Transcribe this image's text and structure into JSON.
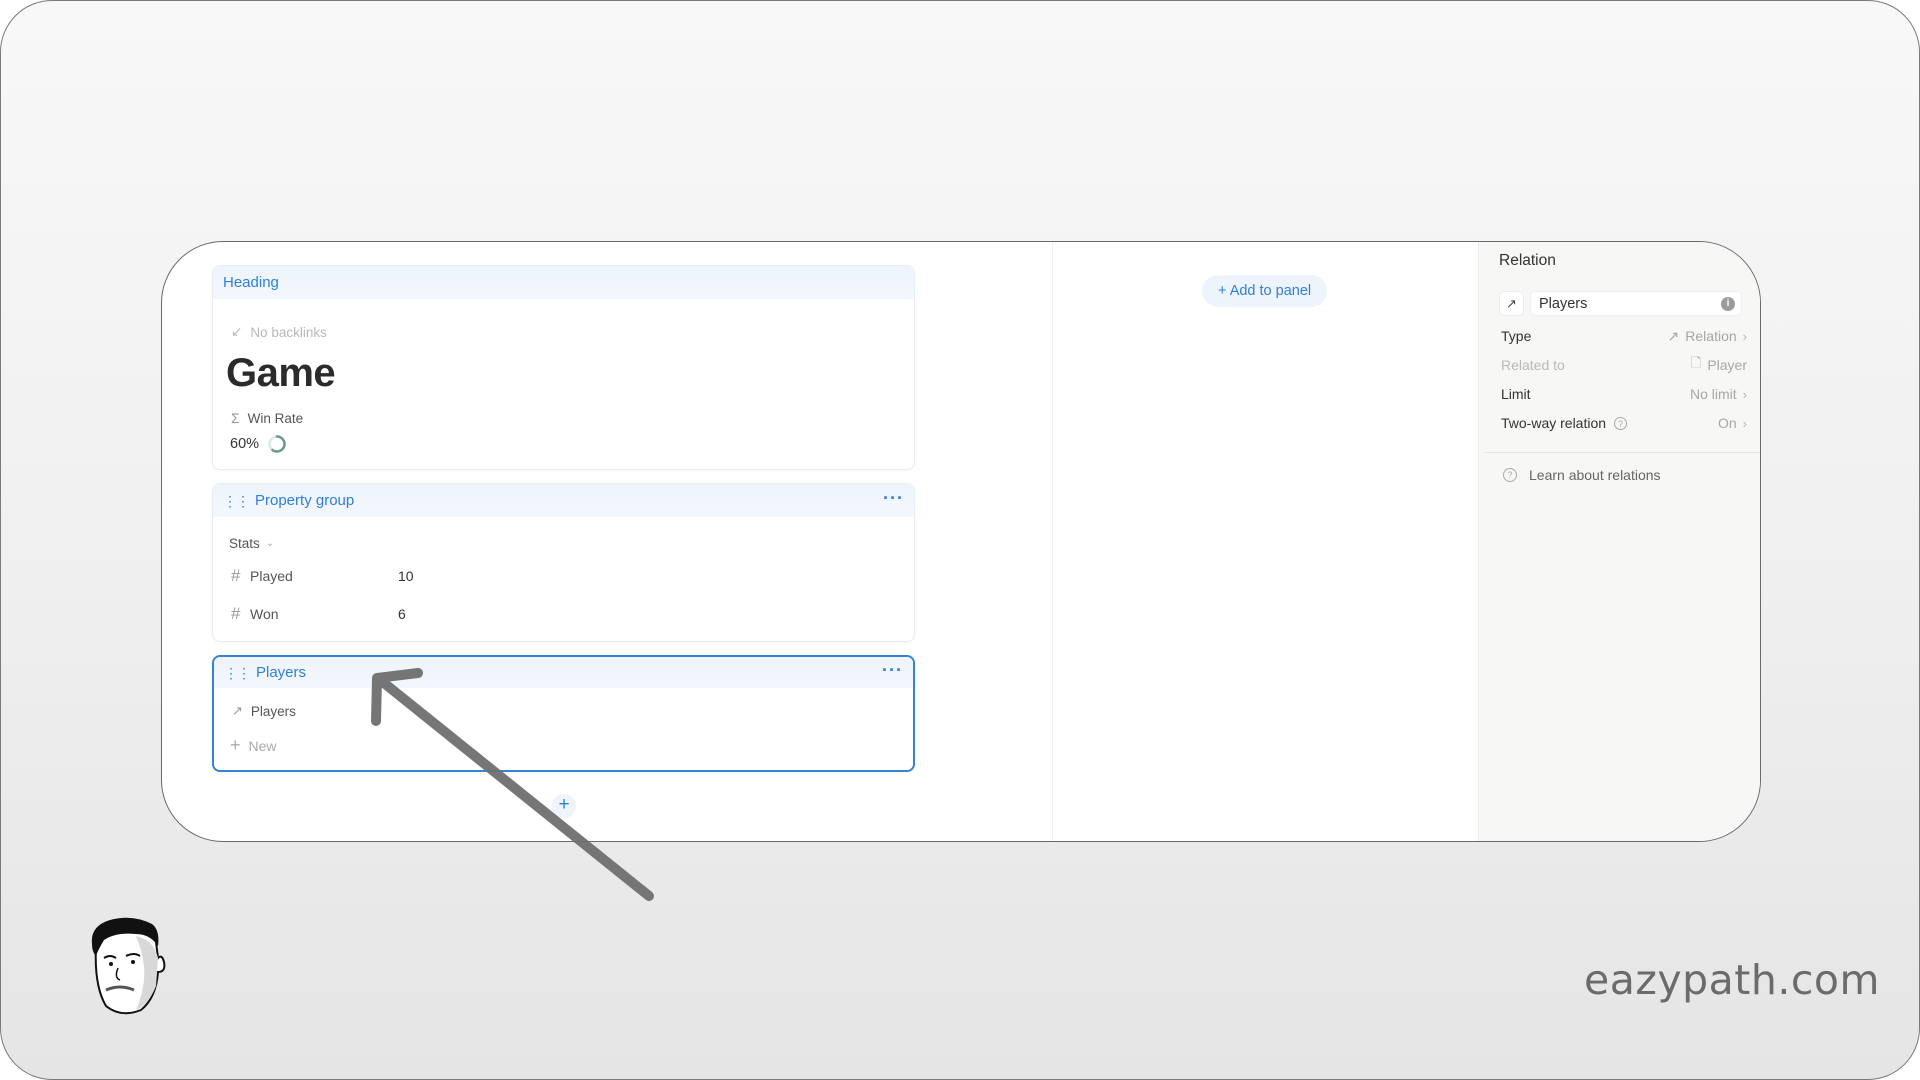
{
  "heading_card": {
    "label": "Heading",
    "backlinks_text": "No backlinks",
    "title": "Game",
    "formula_property": {
      "icon": "sigma-icon",
      "label": "Win Rate",
      "value": "60%",
      "progress": 0.6
    }
  },
  "property_group_card": {
    "label": "Property group",
    "group_name": "Stats",
    "properties": [
      {
        "icon": "hash-icon",
        "label": "Played",
        "value": "10"
      },
      {
        "icon": "hash-icon",
        "label": "Won",
        "value": "6"
      }
    ]
  },
  "players_card": {
    "label": "Players",
    "relation_label": "Players",
    "new_label": "New"
  },
  "add_block_label": "+",
  "add_to_panel_label": "+ Add to panel",
  "side_panel": {
    "title": "Relation",
    "name_value": "Players",
    "rows": [
      {
        "label": "Type",
        "value": "Relation",
        "icon": "arrow-up-right-icon",
        "chevron": true,
        "dim": false
      },
      {
        "label": "Related to",
        "value": "Player",
        "icon": "page-icon",
        "chevron": false,
        "dim": true
      },
      {
        "label": "Limit",
        "value": "No limit",
        "icon": "",
        "chevron": true,
        "dim": false
      },
      {
        "label": "Two-way relation",
        "value": "On",
        "icon": "",
        "chevron": true,
        "dim": false,
        "help": true
      }
    ],
    "learn_link": "Learn about relations"
  },
  "brand": "eazypath.com",
  "colors": {
    "accent": "#2f7fd8",
    "selected_border": "#3383d6",
    "ring": "#6b9a86"
  }
}
